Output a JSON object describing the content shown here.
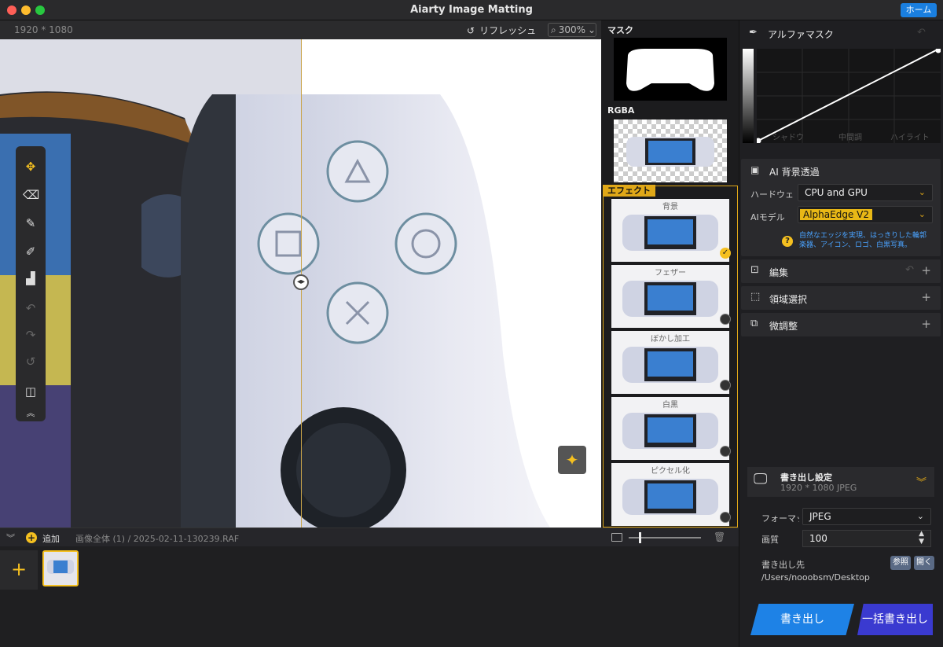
{
  "window": {
    "title": "Aiarty Image Matting",
    "home_label": "ホーム"
  },
  "canvas_bar": {
    "resolution": "1920 * 1080",
    "refresh_label": "リフレッシュ",
    "zoom": "300%"
  },
  "thumbs_column": {
    "mask_label": "マスク",
    "rgba_label": "RGBA",
    "effect_label": "エフェクト",
    "effects": [
      {
        "label": "背景",
        "checked": true
      },
      {
        "label": "フェザー",
        "checked": false
      },
      {
        "label": "ぼかし加工",
        "checked": false
      },
      {
        "label": "白黒",
        "checked": false
      },
      {
        "label": "ピクセル化",
        "checked": false
      }
    ]
  },
  "bottom_bar": {
    "add_label": "追加",
    "breadcrumb": "画像全体 (1)  / 2025-02-11-130239.RAF"
  },
  "alpha_mask": {
    "title": "アルファマスク",
    "labels": [
      "シャドウ",
      "中間調",
      "ハイライト"
    ]
  },
  "ai_bg": {
    "title": "AI 背景透過",
    "hardware_label": "ハードウェア",
    "hardware_value": "CPU and GPU",
    "model_label": "AIモデル",
    "model_value": "AlphaEdge  V2",
    "help_line1": "自然なエッジを実現、はっきりした輪郭",
    "help_line2": "楽器、アイコン、ロゴ、白黒写真。"
  },
  "sections": {
    "edit": "編集",
    "region": "領域選択",
    "fine": "微調整"
  },
  "export": {
    "title": "書き出し設定",
    "subtitle": "1920 * 1080 JPEG",
    "format_label": "フォーマット",
    "format_value": "JPEG",
    "quality_label": "画質",
    "quality_value": "100",
    "dest_label": "書き出し先",
    "browse_label": "参照",
    "open_label": "開く",
    "path": "/Users/nooobsm/Desktop",
    "export_btn": "書き出し",
    "batch_btn": "一括書き出し"
  },
  "colors": {
    "accent": "#e0a818",
    "primary_blue": "#1e82e6",
    "batch_blue": "#3a3ad0"
  }
}
